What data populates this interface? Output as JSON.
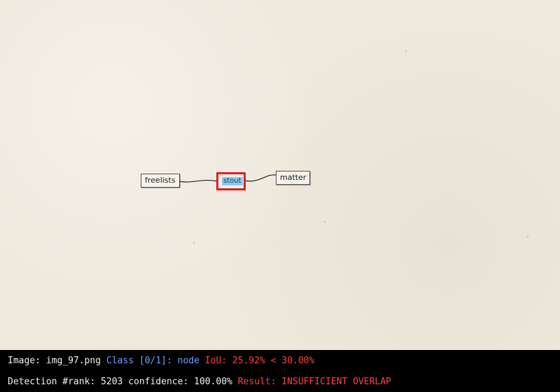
{
  "graph": {
    "nodes": [
      {
        "label": "freelists"
      },
      {
        "label": "stout",
        "selected": true
      },
      {
        "label": "matter"
      }
    ],
    "edges": [
      [
        "freelists",
        "stout"
      ],
      [
        "stout",
        "matter"
      ]
    ]
  },
  "status": {
    "line1": {
      "image_label": "Image:",
      "image_value": "img_97.png",
      "class_label": "Class [0/1]:",
      "class_value": "node",
      "iou_text": "IoU: 25.92% < 30.00%"
    },
    "line2": {
      "detection_text": "Detection #rank: 5203 confidence: 100.00%",
      "result_text": "Result: INSUFFICIENT OVERLAP"
    }
  },
  "colors": {
    "highlight_border": "#e02020",
    "selection_fill": "#8ec8f0",
    "class_text": "#6fa0ff",
    "error_text": "#ff4040"
  }
}
